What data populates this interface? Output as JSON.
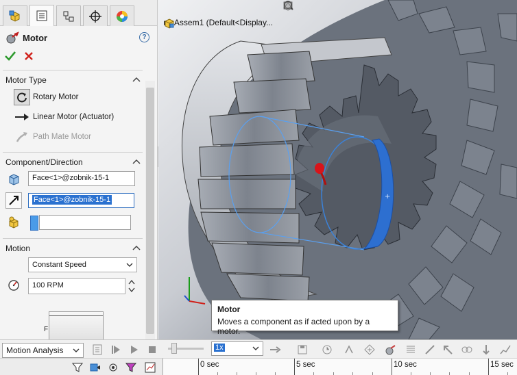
{
  "property_manager": {
    "tabs": [
      {
        "name": "featuremanager-tab",
        "icon": "feature-tree-icon"
      },
      {
        "name": "propertymanager-tab",
        "icon": "property-manager-icon"
      },
      {
        "name": "configurationmanager-tab",
        "icon": "configuration-icon"
      },
      {
        "name": "dimxpert-tab",
        "icon": "crosshair-icon"
      },
      {
        "name": "display-manager-tab",
        "icon": "appearance-icon"
      }
    ],
    "title": "Motor",
    "help": "?",
    "motor_type": {
      "title": "Motor Type",
      "options": [
        {
          "label": "Rotary Motor",
          "state": "selected"
        },
        {
          "label": "Linear Motor (Actuator)",
          "state": "normal"
        },
        {
          "label": "Path Mate Motor",
          "state": "disabled"
        }
      ]
    },
    "component_direction": {
      "title": "Component/Direction",
      "location_value": "Face<1>@zobnik-15-1",
      "direction_value": "Face<1>@zobnik-15-1",
      "component_value": ""
    },
    "motion": {
      "title": "Motion",
      "function": "Constant Speed",
      "speed": "100 RPM",
      "graph_axis_label": "F"
    }
  },
  "viewport": {
    "tree_item": "Assem1  (Default<Display...",
    "colors": {
      "background": "#5d6470",
      "gear": "#8e949e",
      "selection": "#3b82d9"
    }
  },
  "tooltip": {
    "title": "Motor",
    "text": "Moves a component as if acted upon by a motor."
  },
  "motion_bar": {
    "study_type": "Motion Analysis",
    "playback_speed": "1x",
    "timeline_ticks": [
      {
        "label": "0 sec"
      },
      {
        "label": "5 sec"
      },
      {
        "label": "10 sec"
      },
      {
        "label": "15 sec"
      }
    ]
  }
}
